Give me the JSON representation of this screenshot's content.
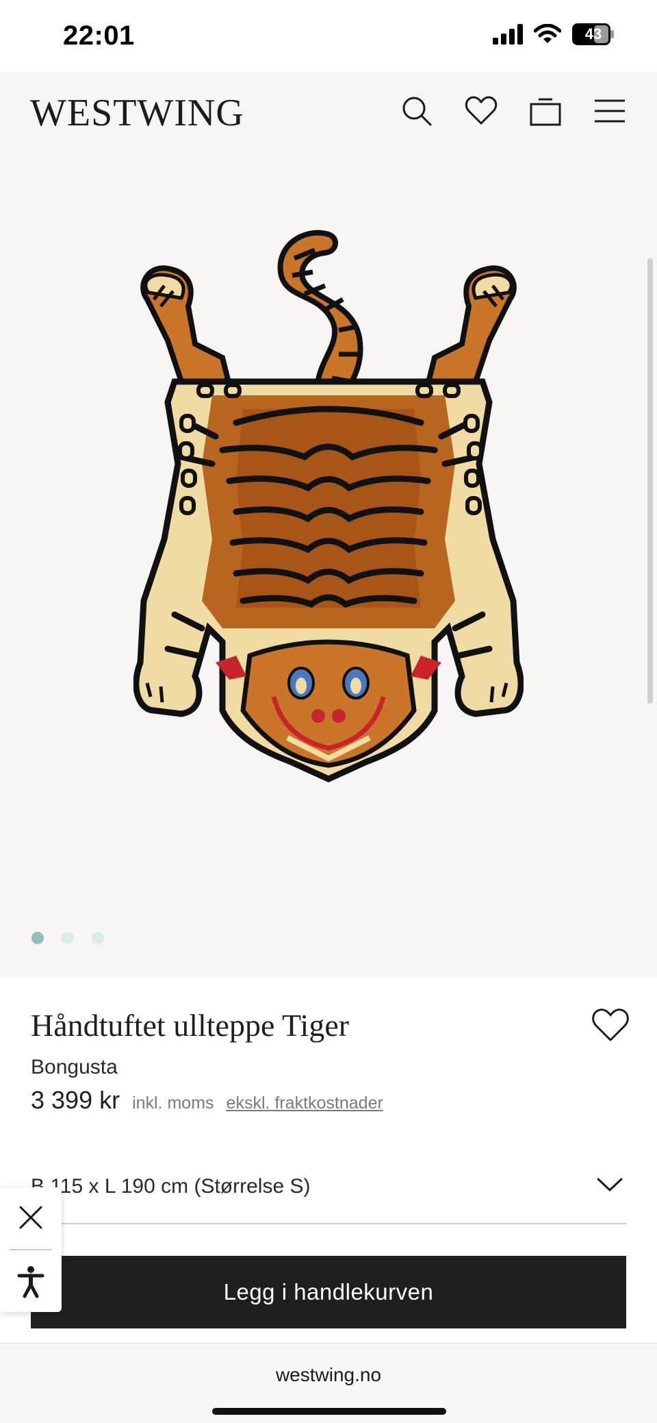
{
  "status_bar": {
    "time": "22:01",
    "battery": "43",
    "icons": [
      "signal-icon",
      "wifi-icon",
      "battery-icon"
    ]
  },
  "header": {
    "logo": "WESTWING",
    "actions": [
      "search-icon",
      "heart-icon",
      "bag-icon",
      "menu-icon"
    ]
  },
  "gallery": {
    "image_subject": "tiger-rug-image",
    "dot_count": 3,
    "active_dot": 0,
    "colors": {
      "active_dot": "#8cc3bd",
      "inactive_dot": "#d8ecea",
      "background": "#f7f5f4"
    }
  },
  "product": {
    "title": "Håndtuftet ullteppe Tiger",
    "brand": "Bongusta",
    "price": "3 399 kr",
    "vat_note": "inkl. moms",
    "shipping_link": "ekskl. fraktkostnader",
    "size_selected": "B 115 x L 190 cm (Størrelse S)",
    "add_to_cart": "Legg i handlekurven"
  },
  "accessibility_widget": {
    "icons": [
      "close-icon",
      "accessibility-icon"
    ]
  },
  "browser": {
    "url": "westwing.no"
  },
  "colors": {
    "button_bg": "#1f1f21",
    "text": "#1f1f1f",
    "muted": "#7a7a7a"
  }
}
